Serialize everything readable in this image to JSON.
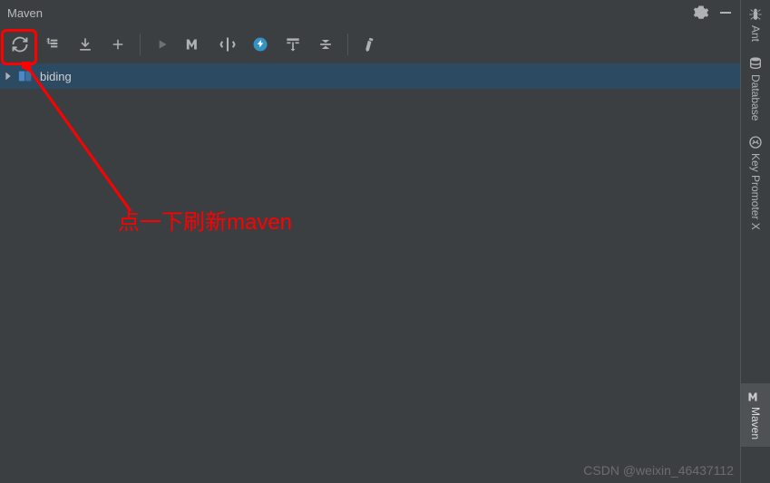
{
  "panel": {
    "title": "Maven"
  },
  "project": {
    "name": "biding"
  },
  "sidebar": {
    "tabs": [
      {
        "label": "Ant"
      },
      {
        "label": "Database"
      },
      {
        "label": "Key Promoter X"
      },
      {
        "label": "Maven"
      }
    ]
  },
  "annotation": {
    "text": "点一下刷新maven"
  },
  "watermark": "CSDN @weixin_46437112"
}
